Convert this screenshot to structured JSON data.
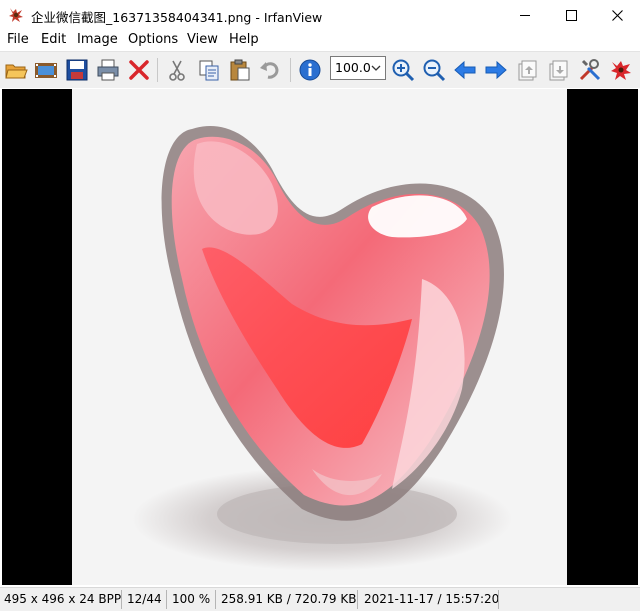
{
  "window": {
    "title": "企业微信截图_16371358404341.png - IrfanView",
    "app_icon": "irfanview-cat-icon",
    "controls": [
      "minimize-icon",
      "maximize-icon",
      "close-icon"
    ]
  },
  "menu": {
    "items": [
      "File",
      "Edit",
      "Image",
      "Options",
      "View",
      "Help"
    ]
  },
  "toolbar": {
    "icons": [
      "open-folder-icon",
      "slideshow-icon",
      "save-icon",
      "print-icon",
      "delete-icon",
      "cut-icon",
      "copy-icon",
      "paste-icon",
      "undo-icon",
      "info-icon",
      "zoom-in-icon",
      "zoom-out-icon",
      "previous-icon",
      "next-icon",
      "first-page-icon",
      "last-page-icon",
      "settings-icon",
      "exit-icon"
    ],
    "zoom_value": "100.0"
  },
  "image": {
    "subject": "heart-image",
    "colors": {
      "heart": "#f47a86",
      "highlight": "#ffd6dc",
      "outline": "#7a6868",
      "shadow": "#c9c2c2"
    }
  },
  "status": {
    "dimensions": "495 x 496 x 24 BPP",
    "index": "12/44",
    "zoom": "100 %",
    "size": "258.91 KB / 720.79 KB",
    "datetime": "2021-11-17 / 15:57:20"
  }
}
